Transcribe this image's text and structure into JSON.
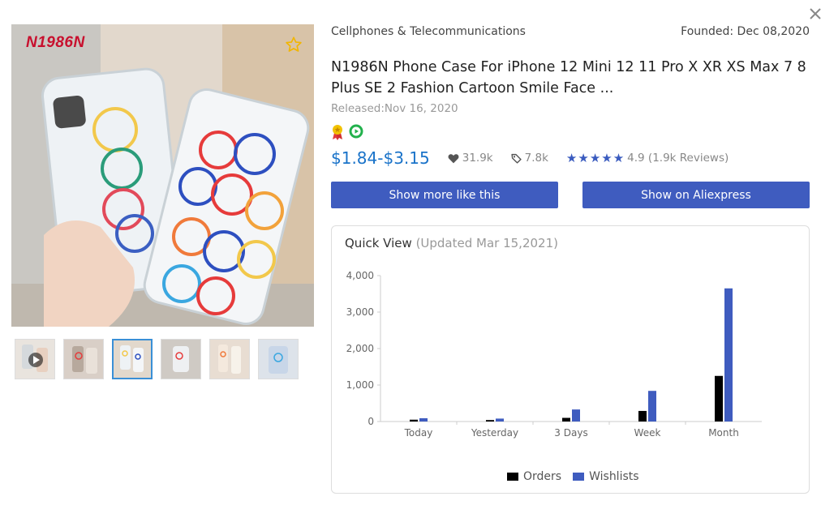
{
  "product": {
    "brand_logo": "N1986N",
    "category": "Cellphones & Telecommunications",
    "founded": "Founded: Dec 08,2020",
    "title": "N1986N Phone Case For iPhone 12 Mini 12 11 Pro X XR XS Max 7 8 Plus SE 2 Fashion Cartoon Smile Face ...",
    "released": "Released:Nov 16, 2020",
    "price": "$1.84-$3.15",
    "likes": "31.9k",
    "tags": "7.8k",
    "stars": "★★★★★",
    "rating": "4.9 (1.9k Reviews)"
  },
  "buttons": {
    "more_like": "Show more like this",
    "aliexpress": "Show on Aliexpress"
  },
  "icons": {
    "close": "close-icon",
    "favorite": "star-outline-icon",
    "likes": "heart-icon",
    "tags": "tag-icon",
    "badge1": "award-ribbon-icon",
    "badge2": "play-circle-icon"
  },
  "colors": {
    "price": "#1a73c9",
    "button": "#3f5cbf",
    "orders": "#000000",
    "wishlists": "#3f5cbf",
    "stars": "#3a5bbf"
  },
  "quick_view": {
    "title": "Quick View",
    "updated": "(Updated Mar 15,2021)"
  },
  "chart_data": {
    "type": "bar",
    "categories": [
      "Today",
      "Yesterday",
      "3 Days",
      "Week",
      "Month"
    ],
    "series": [
      {
        "name": "Orders",
        "values": [
          50,
          40,
          100,
          290,
          1250
        ]
      },
      {
        "name": "Wishlists",
        "values": [
          90,
          80,
          330,
          840,
          3650
        ]
      }
    ],
    "ylim": [
      0,
      4000
    ],
    "yticks": [
      "0",
      "1,000",
      "2,000",
      "3,000",
      "4,000"
    ],
    "ytick_values": [
      0,
      1000,
      2000,
      3000,
      4000
    ],
    "legend": "bottom",
    "grid": false
  }
}
